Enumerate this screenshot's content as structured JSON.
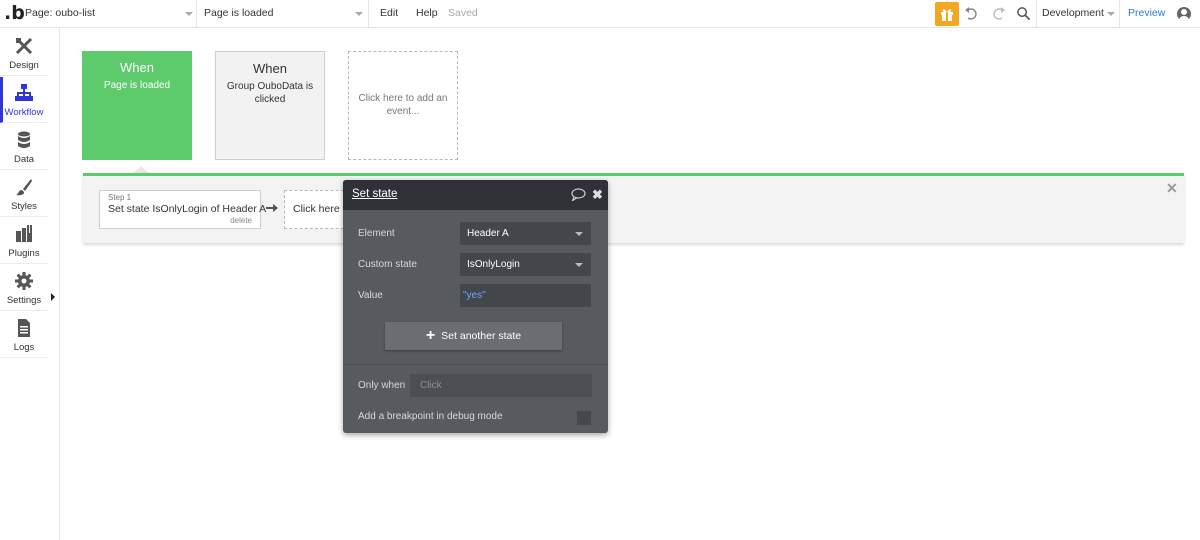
{
  "topbar": {
    "logo": ".b",
    "page_selector": "Page: oubo-list",
    "event_selector": "Page is loaded",
    "menu_edit": "Edit",
    "menu_help": "Help",
    "status": "Saved",
    "environment": "Development",
    "preview": "Preview",
    "gift_color": "#f5a623"
  },
  "sidebar": {
    "items": [
      {
        "label": "Design",
        "icon": "design-icon"
      },
      {
        "label": "Workflow",
        "icon": "workflow-icon"
      },
      {
        "label": "Data",
        "icon": "database-icon"
      },
      {
        "label": "Styles",
        "icon": "brush-icon"
      },
      {
        "label": "Plugins",
        "icon": "plugins-icon"
      },
      {
        "label": "Settings",
        "icon": "gear-icon"
      },
      {
        "label": "Logs",
        "icon": "logs-icon"
      }
    ],
    "active": "Workflow",
    "active_color": "#2f35d6"
  },
  "events": [
    {
      "when": "When",
      "desc": "Page is loaded",
      "color": "#5dcb6b"
    },
    {
      "when": "When",
      "desc": "Group OuboData is clicked"
    },
    {
      "desc": "Click here to add an event..."
    }
  ],
  "workflow": {
    "step": {
      "num": "Step 1",
      "title": "Set state IsOnlyLogin of Header A",
      "delete": "delete"
    },
    "add_action": "Click here to add an action..."
  },
  "property_editor": {
    "title": "Set state",
    "element_label": "Element",
    "element_value": "Header A",
    "custom_state_label": "Custom state",
    "custom_state_value": "IsOnlyLogin",
    "value_label": "Value",
    "value_value": "\"yes\"",
    "set_another_label": "Set another state",
    "only_when_label": "Only when",
    "only_when_placeholder": "Click",
    "breakpoint_label": "Add a breakpoint in debug mode"
  }
}
